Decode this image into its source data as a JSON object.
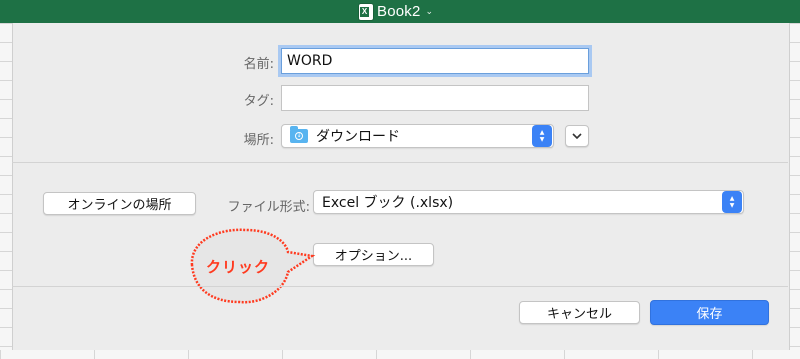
{
  "titlebar": {
    "title": "Book2",
    "app_icon": "excel-icon",
    "chevron": "chevron-down-icon",
    "color": "#1e7145"
  },
  "save_dialog": {
    "name_label": "名前:",
    "name_value": "WORD",
    "tags_label": "タグ:",
    "tags_value": "",
    "location_label": "場所:",
    "location_value": "ダウンロード",
    "location_icon": "downloads-folder-icon"
  },
  "format_section": {
    "online_locations_button": "オンラインの場所",
    "file_format_label": "ファイル形式:",
    "file_format_value": "Excel ブック (.xlsx)",
    "options_button": "オプション..."
  },
  "annotation": {
    "text": "クリック",
    "color": "#ff3a1f"
  },
  "footer": {
    "cancel_button": "キャンセル",
    "save_button": "保存",
    "accent": "#3b82f6"
  }
}
